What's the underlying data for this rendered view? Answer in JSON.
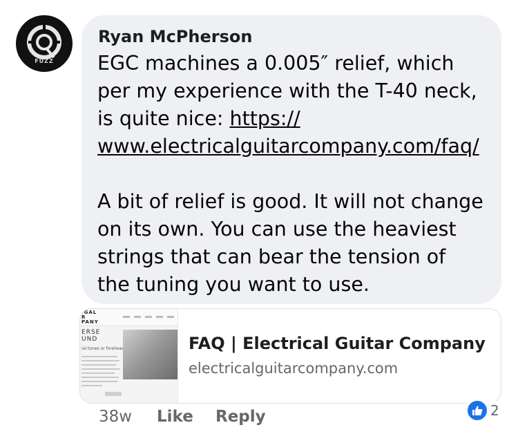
{
  "avatar": {
    "label": "FUZZ"
  },
  "comment": {
    "author": "Ryan McPherson",
    "line1": "EGC machines a 0.005″ relief, which",
    "line2": "per my experience with the T-40 neck,",
    "line3_prefix": "is quite nice: ",
    "link_part1": "https://",
    "link_part2": "www.electricalguitarcompany.com/faq/",
    "para2_line1": "A bit of relief is good. It will not change",
    "para2_line2": "on its own. You can use the heaviest",
    "para2_line3": "strings that can bear the tension of",
    "para2_line4": "the tuning you want to use."
  },
  "preview": {
    "title": "FAQ | Electrical Guitar Company",
    "domain": "electricalguitarcompany.com",
    "thumb_logo": "IGAL\nR\nPANY",
    "thumb_heading": "ERSE\nUND",
    "thumb_sub": "ial tones or forehead"
  },
  "actions": {
    "time": "38w",
    "like": "Like",
    "reply": "Reply"
  },
  "reactions": {
    "count": "2",
    "icon": "thumbs-up-icon",
    "color": "#1b74e4"
  }
}
